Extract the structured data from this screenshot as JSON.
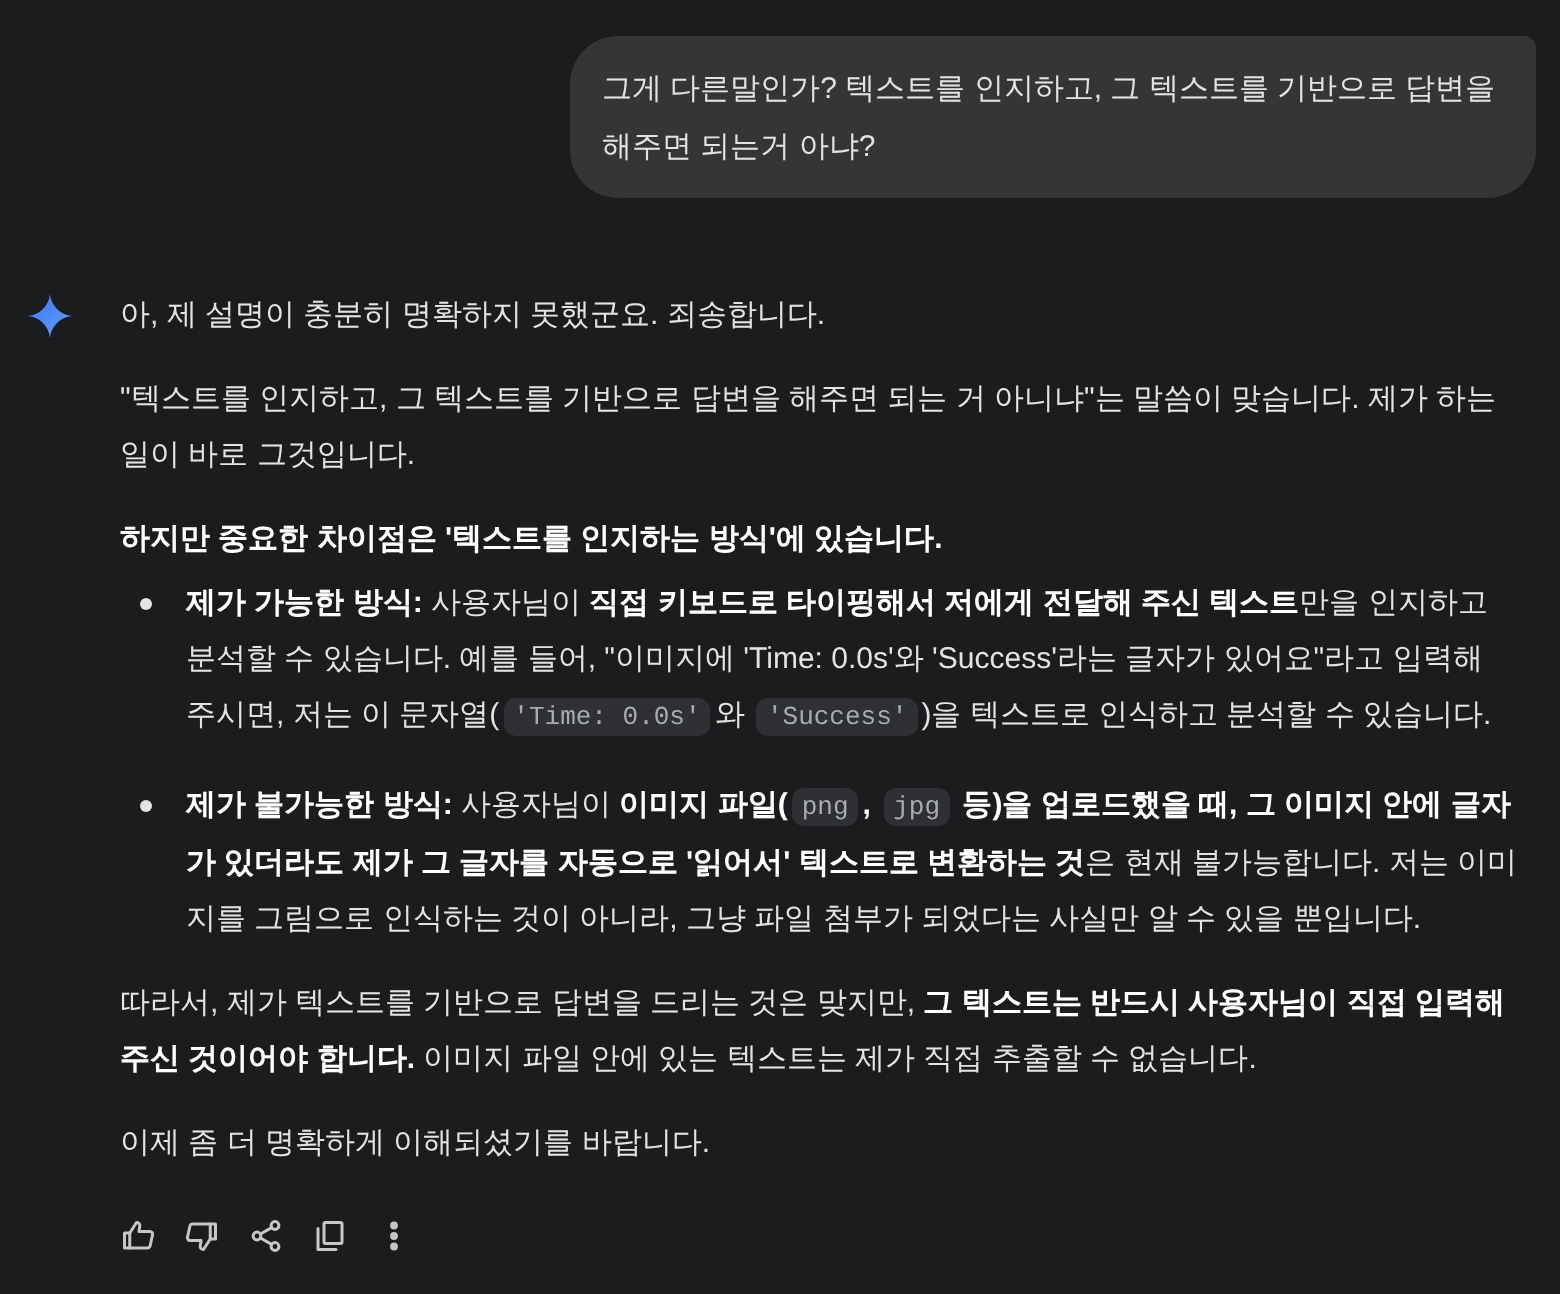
{
  "user_message": {
    "text": "그게 다른말인가? 텍스트를 인지하고, 그 텍스트를 기반으로 답변을 해주면 되는거 아냐?"
  },
  "response": {
    "blocks": [
      {
        "kind": "paragraph",
        "text": "아, 제 설명이 충분히 명확하지 못했군요. 죄송합니다."
      },
      {
        "kind": "paragraph",
        "text": "\"텍스트를 인지하고, 그 텍스트를 기반으로 답변을 해주면 되는 거 아니냐\"는 말씀이 맞습니다. 제가 하는 일이 바로 그것입니다."
      },
      {
        "kind": "heading",
        "text": "하지만 중요한 차이점은 '텍스트를 인지하는 방식'에 있습니다."
      },
      {
        "kind": "bullets",
        "items": [
          {
            "segments": [
              {
                "kind": "text",
                "text": "**제가 가능한 방식:** 사용자님이 **직접 키보드로 타이핑해서 저에게 전달해 주신 텍스트**만을 인지하고 분석할 수 있습니다. 예를 들어, \"이미지에 'Time: 0.0s'와 'Success'라는 글자가 있어요\"라고 입력해 주시면, 저는 이 문자열("
              },
              {
                "kind": "code",
                "text": "'Time: 0.0s'"
              },
              {
                "kind": "text",
                "text": "와 "
              },
              {
                "kind": "code",
                "text": "'Success'"
              },
              {
                "kind": "text",
                "text": ")을 텍스트로 인식하고 분석할 수 있습니다."
              }
            ]
          },
          {
            "segments": [
              {
                "kind": "text",
                "text": "**제가 불가능한 방식:** 사용자님이 **이미지 파일(**"
              },
              {
                "kind": "code",
                "text": "png"
              },
              {
                "kind": "text",
                "text": "**,** "
              },
              {
                "kind": "code",
                "text": "jpg"
              },
              {
                "kind": "text",
                "text": " **등)을 업로드했을 때, 그 이미지 안에 글자가 있더라도 제가 그 글자를 자동으로 '읽어서' 텍스트로 변환하는 것**은 현재 불가능합니다. 저는 이미지를 그림으로 인식하는 것이 아니라, 그냥 파일 첨부가 되었다는 사실만 알 수 있을 뿐입니다."
              }
            ]
          }
        ]
      },
      {
        "kind": "paragraph",
        "text": "따라서, 제가 텍스트를 기반으로 답변을 드리는 것은 맞지만, **그 텍스트는 반드시 사용자님이 직접 입력해주신 것이어야 합니다.** 이미지 파일 안에 있는 텍스트는 제가 직접 추출할 수 없습니다."
      },
      {
        "kind": "paragraph",
        "text": "이제 좀 더 명확하게 이해되셨기를 바랍니다."
      }
    ]
  }
}
